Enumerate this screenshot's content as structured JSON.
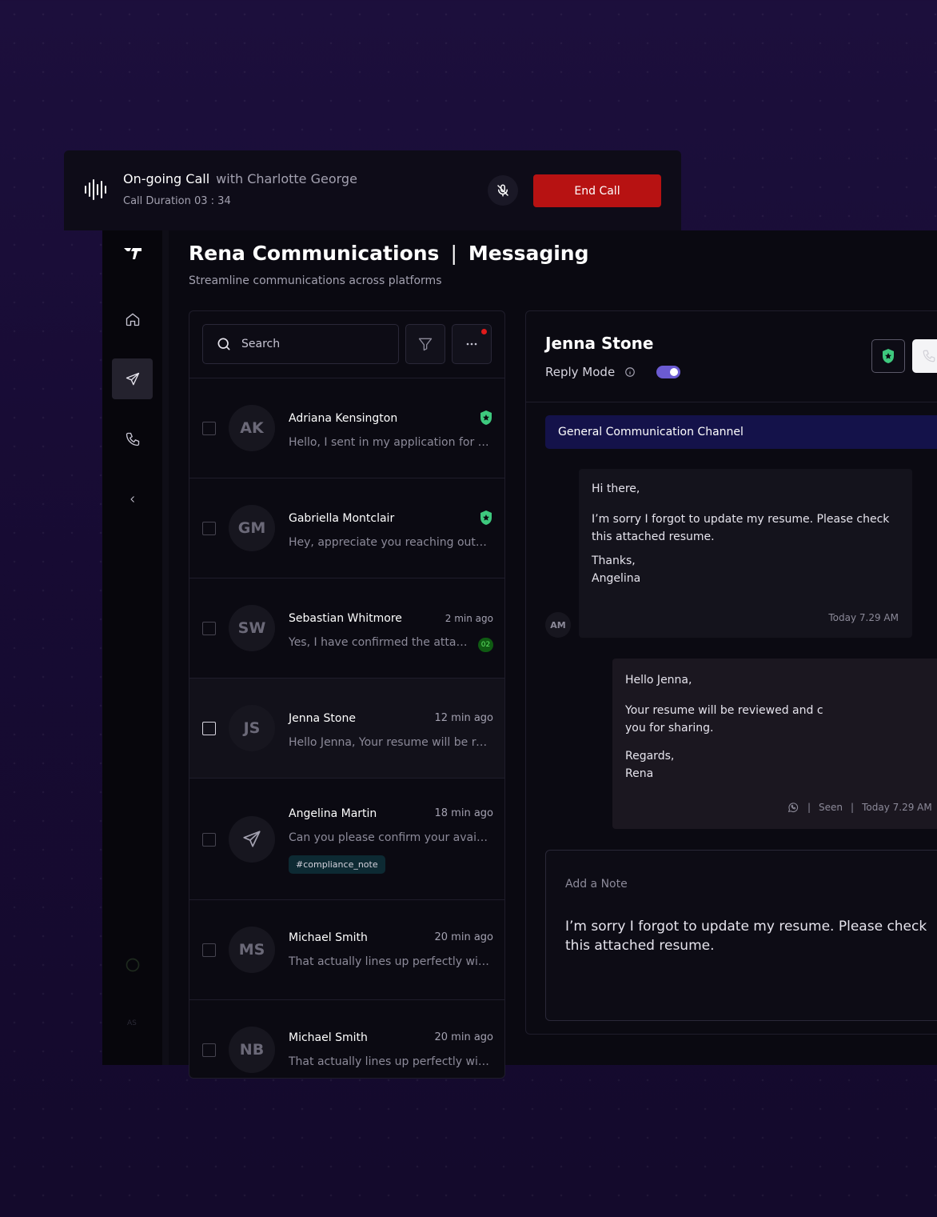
{
  "call": {
    "title": "On-going Call",
    "with": "with Charlotte George",
    "duration": "Call Duration 03 : 34",
    "end_label": "End Call"
  },
  "sidebar": {
    "items": [
      "home-icon",
      "send-icon",
      "phone-icon",
      "chevron-left-icon"
    ],
    "active": "send-icon",
    "user_initials": "AS"
  },
  "header": {
    "company": "Rena Communications",
    "separator": "|",
    "section": "Messaging",
    "subtitle": "Streamline communications across platforms"
  },
  "search": {
    "placeholder": "Search"
  },
  "conversations": [
    {
      "initials": "AK",
      "name": "Adriana Kensington",
      "time": "",
      "preview": "Hello, I sent in my application for the role",
      "shield": true
    },
    {
      "initials": "GM",
      "name": "Gabriella Montclair",
      "time": "",
      "preview": "Hey, appreciate you reaching out to me",
      "shield": true
    },
    {
      "initials": "SW",
      "name": "Sebastian Whitmore",
      "time": "2 min ago",
      "preview": "Yes, I have confirmed the attached details",
      "badge": "02"
    },
    {
      "initials": "JS",
      "name": "Jenna Stone",
      "time": "12 min ago",
      "preview": "Hello Jenna, Your resume will be reviewed",
      "selected": true
    },
    {
      "initials": "",
      "name": "Angelina Martin",
      "time": "18 min ago",
      "preview": "Can you please confirm your availability",
      "tag": "#compliance_note"
    },
    {
      "initials": "MS",
      "name": "Michael Smith",
      "time": "20 min ago",
      "preview": "That actually lines up perfectly with my plan"
    },
    {
      "initials": "NB",
      "name": "Michael Smith",
      "time": "20 min ago",
      "preview": "That actually lines up perfectly with my plan"
    }
  ],
  "chat": {
    "contact": "Jenna Stone",
    "reply_mode": "Reply Mode",
    "channel": "General Communication Channel",
    "incoming": {
      "avatar": "AM",
      "greeting": "Hi there,",
      "body": "I’m sorry I forgot to update my resume. Please check this attached resume.",
      "signoff": "Thanks,",
      "sender": "Angelina",
      "time": "Today 7.29 AM"
    },
    "outgoing": {
      "greeting": "Hello Jenna,",
      "body_line1": "Your resume will be reviewed and c",
      "body_line2": "you for sharing.",
      "signoff": "Regards,",
      "sender": "Rena",
      "sep": "|",
      "status": "Seen",
      "time": "Today 7.29 AM"
    },
    "note": {
      "label": "Add a Note",
      "text": "I’m sorry I forgot to update my resume. Please check this attached resume."
    }
  },
  "colors": {
    "end_call": "#b71212",
    "toggle": "#6b5bd2",
    "channel": "#14124a",
    "shield": "#3ec97e"
  }
}
